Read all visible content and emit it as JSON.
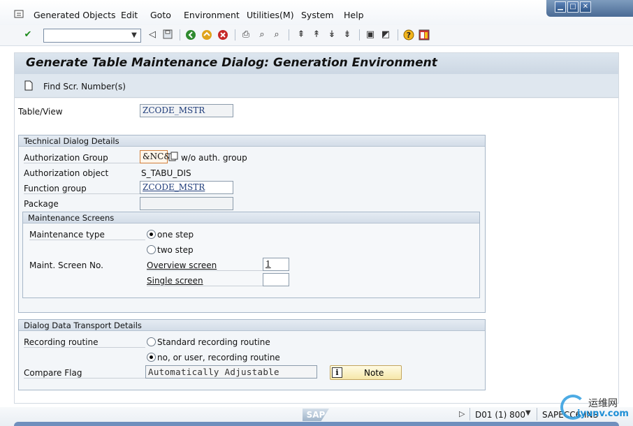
{
  "menu": {
    "items": [
      "Generated Objects",
      "Edit",
      "Goto",
      "Environment",
      "Utilities(M)",
      "System",
      "Help"
    ]
  },
  "toolbar": {
    "command_value": "",
    "icons": [
      "enter-icon",
      "back-icon",
      "save-icon",
      "back-nav-icon",
      "exit-icon",
      "cancel-icon",
      "print-icon",
      "find-icon",
      "find-next-icon",
      "first-page-icon",
      "prev-page-icon",
      "next-page-icon",
      "last-page-icon",
      "create-session-icon",
      "shortcut-icon",
      "help-icon",
      "layout-icon"
    ]
  },
  "page": {
    "title": "Generate Table Maintenance Dialog: Generation Environment",
    "find_scr_label": "Find Scr. Number(s)"
  },
  "table_view": {
    "label": "Table/View",
    "value": "ZCODE_MSTR"
  },
  "technical": {
    "header": "Technical Dialog Details",
    "auth_group_label": "Authorization Group",
    "auth_group_value": "&NC&",
    "auth_group_desc": "w/o auth. group",
    "auth_object_label": "Authorization object",
    "auth_object_value": "S_TABU_DIS",
    "function_group_label": "Function group",
    "function_group_value": "ZCODE_MSTR",
    "package_label": "Package",
    "package_value": ""
  },
  "maint_screens": {
    "header": "Maintenance Screens",
    "type_label": "Maintenance type",
    "one_step": "one step",
    "two_step": "two step",
    "selected": "one step",
    "screen_no_label": "Maint. Screen No.",
    "overview_label": "Overview screen",
    "overview_value": "1",
    "single_label": "Single screen",
    "single_value": ""
  },
  "transport": {
    "header": "Dialog Data Transport Details",
    "recording_label": "Recording routine",
    "standard_option": "Standard recording routine",
    "no_user_option": "no, or user, recording routine",
    "selected": "no, or user, recording routine",
    "compare_label": "Compare Flag",
    "compare_value": "Automatically Adjustable",
    "note_label": "Note"
  },
  "status": {
    "logo": "SAP",
    "system": "D01 (1) 800",
    "server": "SAPECC6",
    "mode": "INS"
  },
  "watermark": {
    "text_cn": "运维网",
    "text_url": "iyunv.com"
  },
  "colors": {
    "title_bar": "#ccd7e3",
    "group_header": "#d3dde8",
    "note_button": "#f6e7a9",
    "window_controls": "#4a6b95"
  }
}
